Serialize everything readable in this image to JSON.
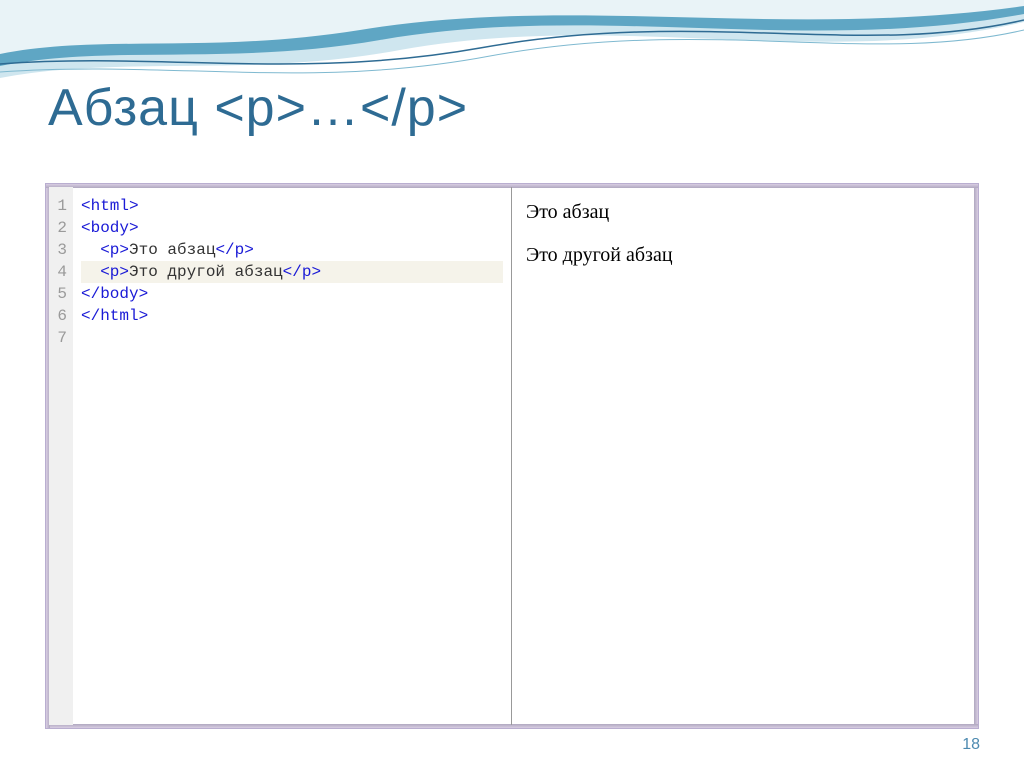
{
  "title": "Абзац  <p>…</p>",
  "page_number": "18",
  "code": {
    "line_numbers": [
      "1",
      "2",
      "3",
      "4",
      "5",
      "6",
      "7"
    ],
    "highlighted_line_index": 3,
    "lines": [
      {
        "indent": 0,
        "open_tag": "<html>",
        "content": "",
        "close_tag": ""
      },
      {
        "indent": 0,
        "open_tag": "<body>",
        "content": "",
        "close_tag": ""
      },
      {
        "indent": 1,
        "open_tag": "<p>",
        "content": "Это абзац",
        "close_tag": "</p>"
      },
      {
        "indent": 1,
        "open_tag": "<p>",
        "content": "Это другой абзац",
        "close_tag": "</p>"
      },
      {
        "indent": 0,
        "open_tag": "</body>",
        "content": "",
        "close_tag": ""
      },
      {
        "indent": 0,
        "open_tag": "</html>",
        "content": "",
        "close_tag": ""
      },
      {
        "indent": 0,
        "open_tag": "",
        "content": "",
        "close_tag": ""
      }
    ]
  },
  "preview": {
    "p1": "Это абзац",
    "p2": "Это другой абзац"
  },
  "colors": {
    "title": "#2e6b93",
    "tag": "#1a1ad6",
    "page_num": "#4d8ab0"
  }
}
